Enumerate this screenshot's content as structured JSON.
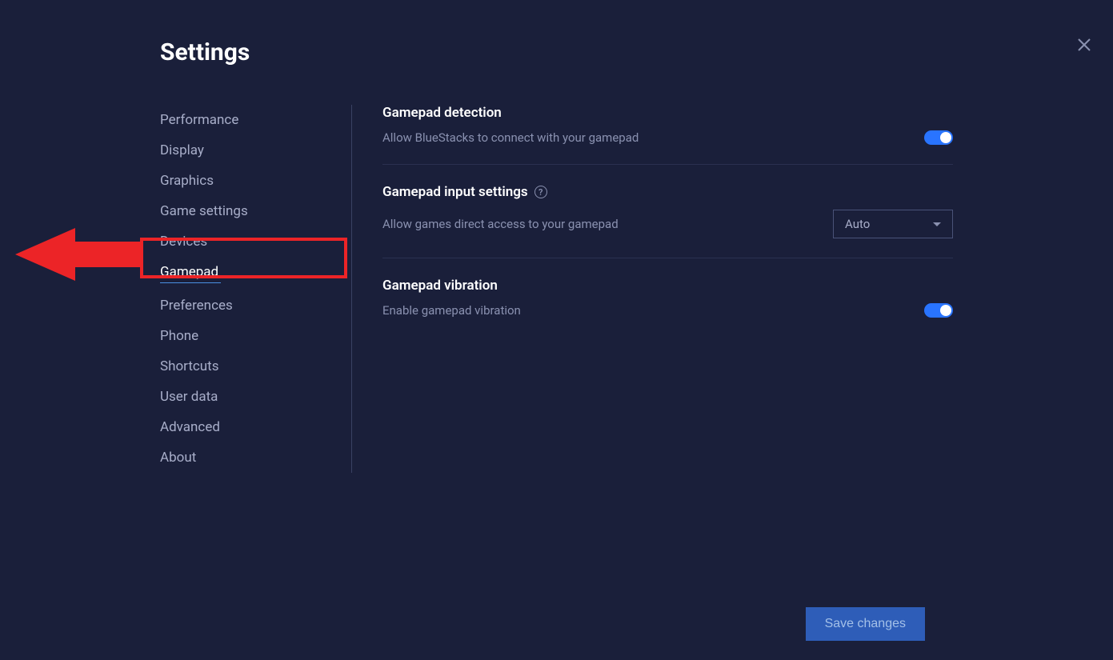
{
  "title": "Settings",
  "sidebar": {
    "items": [
      {
        "label": "Performance",
        "active": false
      },
      {
        "label": "Display",
        "active": false
      },
      {
        "label": "Graphics",
        "active": false
      },
      {
        "label": "Game settings",
        "active": false
      },
      {
        "label": "Devices",
        "active": false
      },
      {
        "label": "Gamepad",
        "active": true
      },
      {
        "label": "Preferences",
        "active": false
      },
      {
        "label": "Phone",
        "active": false
      },
      {
        "label": "Shortcuts",
        "active": false
      },
      {
        "label": "User data",
        "active": false
      },
      {
        "label": "Advanced",
        "active": false
      },
      {
        "label": "About",
        "active": false
      }
    ]
  },
  "sections": {
    "detection": {
      "title": "Gamepad detection",
      "desc": "Allow BlueStacks to connect with your gamepad",
      "toggle": true
    },
    "input": {
      "title": "Gamepad input settings",
      "desc": "Allow games direct access to your gamepad",
      "select_value": "Auto"
    },
    "vibration": {
      "title": "Gamepad vibration",
      "desc": "Enable gamepad vibration",
      "toggle": true
    }
  },
  "buttons": {
    "save": "Save changes"
  }
}
